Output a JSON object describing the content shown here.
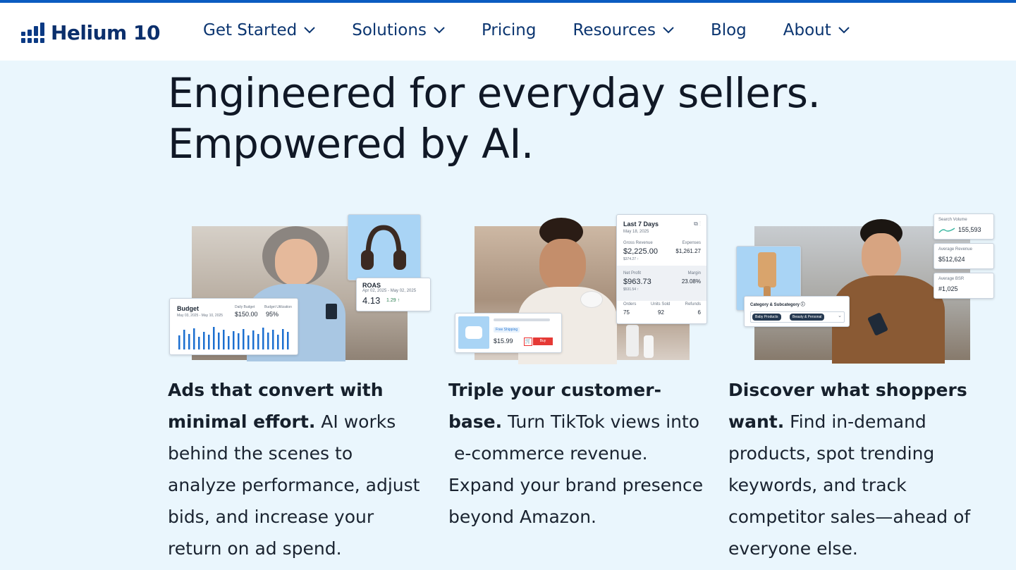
{
  "header": {
    "logo_text": "Helium 10",
    "nav": [
      {
        "label": "Get Started",
        "has_dropdown": true
      },
      {
        "label": "Solutions",
        "has_dropdown": true
      },
      {
        "label": "Pricing",
        "has_dropdown": false
      },
      {
        "label": "Resources",
        "has_dropdown": true
      },
      {
        "label": "Blog",
        "has_dropdown": false
      },
      {
        "label": "About",
        "has_dropdown": true
      }
    ],
    "accent_color": "#0b5cc1",
    "nav_color": "#0b3570"
  },
  "hero": {
    "line1": "Engineered for everyday sellers.",
    "line2": "Empowered by AI."
  },
  "cards": [
    {
      "bold_line1": "Ads that convert with",
      "bold_line2": "minimal effort.",
      "text_line2_rest": " AI works",
      "lines": [
        "behind the scenes to",
        "analyze performance, adjust",
        "bids, and increase your",
        "return on ad spend."
      ],
      "widgets": {
        "budget_title": "Budget",
        "budget_dates": "May 03, 2025 - May 10, 2025",
        "daily_budget_label": "Daily Budget",
        "daily_budget_value": "$150.00",
        "utilization_label": "Budget Utilization",
        "utilization_value": "95%",
        "roas_title": "ROAS",
        "roas_dates": "Apr 02, 2025 - May 02, 2025",
        "roas_value": "4.13",
        "roas_change": "1.29 ↑"
      }
    },
    {
      "bold_line1": "Triple your customer-",
      "bold_line2": "base.",
      "text_line2_rest": " Turn TikTok views into",
      "lines": [
        " e-commerce revenue.",
        "Expand your brand presence",
        "beyond Amazon."
      ],
      "widgets": {
        "last7_title": "Last 7 Days",
        "last7_date": "May 18, 2025",
        "gross_revenue_label": "Gross Revenue",
        "gross_revenue_value": "$2,225.00",
        "gross_revenue_sub": "$374.27 ↑",
        "expenses_label": "Expenses",
        "expenses_value": "$1,261.27",
        "net_profit_label": "Net Profit",
        "net_profit_value": "$963.73",
        "net_profit_sub": "$531.54 ↑",
        "margin_label": "Margin",
        "margin_value": "23.08%",
        "orders_label": "Orders",
        "orders_value": "75",
        "units_label": "Units Sold",
        "units_value": "92",
        "refunds_label": "Refunds",
        "refunds_value": "6",
        "shipping_label": "Free Shipping",
        "product_price": "$15.99",
        "buy_label": "Buy"
      }
    },
    {
      "bold_line1": "Discover what shoppers",
      "bold_line2": "want.",
      "text_line2_rest": " Find in-demand",
      "lines": [
        "products, spot trending",
        "keywords, and track",
        "competitor sales—ahead of",
        "everyone else."
      ],
      "widgets": {
        "search_volume_label": "Search Volume",
        "search_volume_value": "155,593",
        "avg_revenue_label": "Average Revenue",
        "avg_revenue_value": "$512,624",
        "avg_bsr_label": "Average BSR",
        "avg_bsr_value": "#1,025",
        "category_label": "Category & Subcategory ⓘ",
        "category_tag1": "Baby Products",
        "category_tag2": "Beauty & Personal"
      }
    }
  ]
}
